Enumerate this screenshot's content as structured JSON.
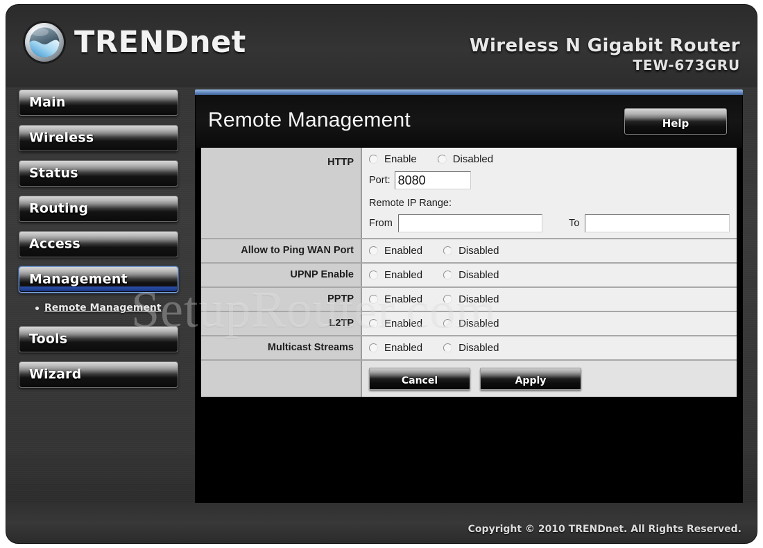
{
  "brand": {
    "name": "TRENDnet",
    "logo_icon": "trendnet-globe-icon"
  },
  "header": {
    "product_line": "Wireless N Gigabit Router",
    "model": "TEW-673GRU"
  },
  "sidebar": {
    "items": [
      {
        "label": "Main",
        "active": false
      },
      {
        "label": "Wireless",
        "active": false
      },
      {
        "label": "Status",
        "active": false
      },
      {
        "label": "Routing",
        "active": false
      },
      {
        "label": "Access",
        "active": false
      },
      {
        "label": "Management",
        "active": true
      },
      {
        "label": "Tools",
        "active": false
      },
      {
        "label": "Wizard",
        "active": false
      }
    ],
    "submenu": [
      {
        "label": "Remote Management",
        "parent": "Management"
      }
    ]
  },
  "panel": {
    "title": "Remote Management",
    "help_label": "Help"
  },
  "form": {
    "http": {
      "label": "HTTP",
      "radio_enable": "Enable",
      "radio_disabled": "Disabled",
      "port_label": "Port:",
      "port_value": "8080",
      "range_title": "Remote IP Range:",
      "from_label": "From",
      "from_value": "",
      "to_label": "To",
      "to_value": ""
    },
    "rows": [
      {
        "label": "Allow to Ping WAN Port",
        "enabled_label": "Enabled",
        "disabled_label": "Disabled"
      },
      {
        "label": "UPNP Enable",
        "enabled_label": "Enabled",
        "disabled_label": "Disabled"
      },
      {
        "label": "PPTP",
        "enabled_label": "Enabled",
        "disabled_label": "Disabled"
      },
      {
        "label": "L2TP",
        "enabled_label": "Enabled",
        "disabled_label": "Disabled"
      },
      {
        "label": "Multicast Streams",
        "enabled_label": "Enabled",
        "disabled_label": "Disabled"
      }
    ],
    "actions": {
      "cancel_label": "Cancel",
      "apply_label": "Apply"
    }
  },
  "watermark": {
    "text": "SetupRouter.com"
  },
  "footer": {
    "copyright": "Copyright © 2010 TRENDnet. All Rights Reserved."
  },
  "colors": {
    "shell_background": "#343434",
    "panel_header": "#101010",
    "panel_accent": "#6d93c8",
    "label_column": "#cfcfcf",
    "field_column": "#efefef",
    "active_nav_underline": "#2b4fa8"
  }
}
